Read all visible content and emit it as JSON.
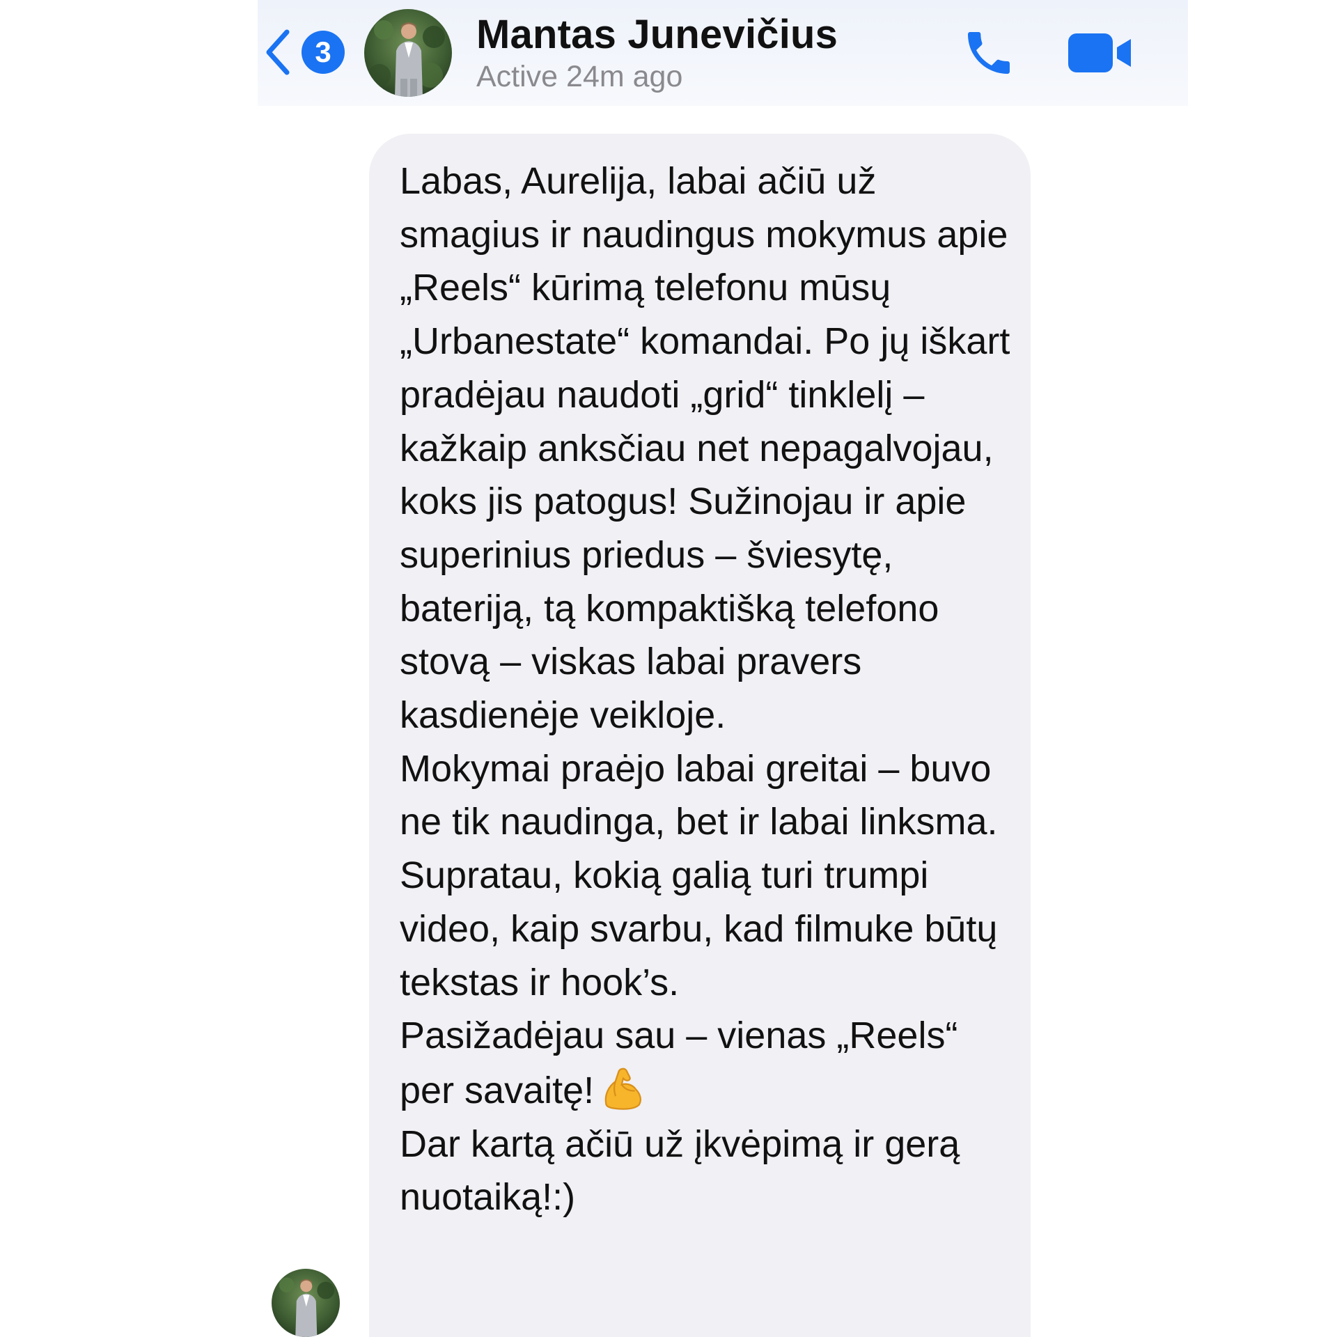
{
  "header": {
    "back_badge_count": "3",
    "contact_name": "Mantas Junevičius",
    "status": "Active 24m ago",
    "icons": {
      "back": "chevron-left-icon",
      "call": "phone-icon",
      "video": "video-camera-icon"
    }
  },
  "colors": {
    "accent": "#1a73f2",
    "bubble_bg": "#f0f0f5",
    "header_bg": "#eef2fa",
    "status_text": "#8a8a8e"
  },
  "message": {
    "paragraphs": [
      "Labas, Aurelija, labai ačiū už smagius ir naudingus mokymus apie „Reels“ kūrimą telefonu mūsų „Urbanestate“ komandai. Po jų iškart pradėjau naudoti „grid“ tinklelį – kažkaip anksčiau net nepagalvojau, koks jis patogus! Sužinojau ir apie superinius priedus – šviesytę, bateriją, tą kompaktišką telefono stovą – viskas labai pravers kasdienėje veikloje.",
      "Mokymai praėjo labai greitai – buvo ne tik naudinga, bet ir labai linksma. Supratau, kokią galią turi trumpi video, kaip svarbu, kad filmuke būtų tekstas ir hook’s.",
      "Pasižadėjau sau – vienas „Reels“ per savaitę!",
      "Dar kartą ačiū už įkvėpimą ir gerą nuotaiką!:)"
    ],
    "emoji": "flexed-biceps-emoji"
  }
}
